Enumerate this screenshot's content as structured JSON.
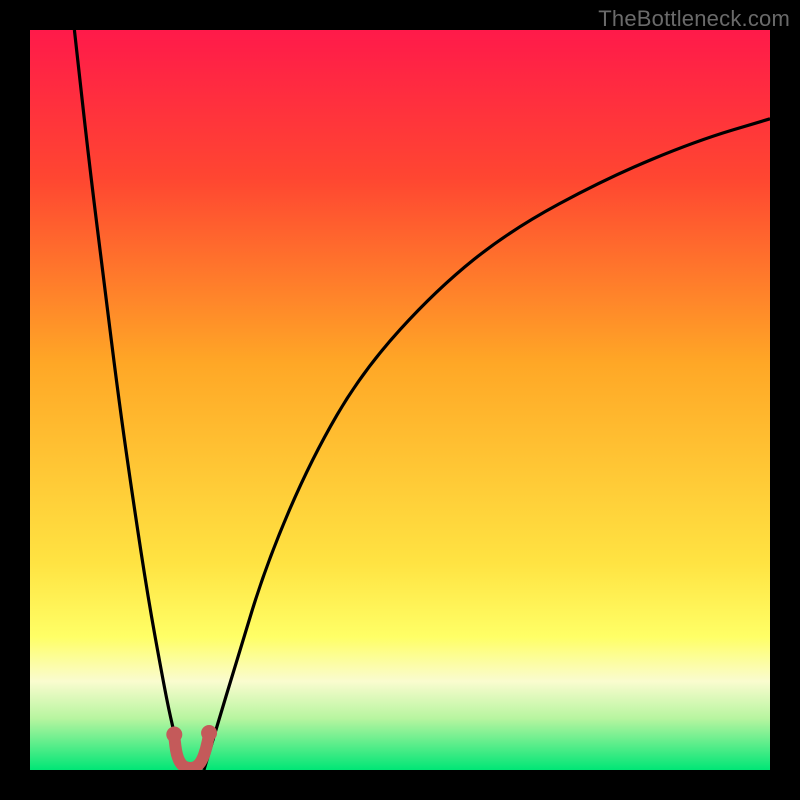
{
  "watermark": "TheBottleneck.com",
  "chart_data": {
    "type": "line",
    "title": "",
    "xlabel": "",
    "ylabel": "",
    "xlim": [
      0,
      100
    ],
    "ylim": [
      0,
      100
    ],
    "grid": false,
    "legend": false,
    "annotations": [],
    "background_gradient": {
      "stops": [
        {
          "pos": 0,
          "color": "#ff1a4a"
        },
        {
          "pos": 20,
          "color": "#ff4631"
        },
        {
          "pos": 45,
          "color": "#ffa726"
        },
        {
          "pos": 72,
          "color": "#ffe342"
        },
        {
          "pos": 82,
          "color": "#ffff66"
        },
        {
          "pos": 88,
          "color": "#fafccf"
        },
        {
          "pos": 93,
          "color": "#b8f5a0"
        },
        {
          "pos": 100,
          "color": "#00e676"
        }
      ]
    },
    "series": [
      {
        "name": "curve-left",
        "stroke": "#000000",
        "x": [
          6,
          8,
          10,
          12,
          14,
          16,
          18,
          19,
          20,
          20.8
        ],
        "y": [
          100,
          82,
          66,
          50,
          36,
          23,
          12,
          7,
          3,
          0
        ]
      },
      {
        "name": "curve-right",
        "stroke": "#000000",
        "x": [
          23.5,
          25,
          28,
          32,
          38,
          45,
          55,
          65,
          78,
          90,
          100
        ],
        "y": [
          0,
          5,
          15,
          28,
          42,
          54,
          65,
          73,
          80,
          85,
          88
        ]
      },
      {
        "name": "valley-marker",
        "stroke": "#c45a5a",
        "thick": true,
        "x": [
          19.5,
          19.8,
          20.5,
          21.5,
          22.5,
          23.2,
          23.8,
          24.2
        ],
        "y": [
          4.5,
          2.0,
          0.6,
          0.2,
          0.4,
          1.2,
          2.8,
          4.8
        ]
      }
    ],
    "valley_dots": {
      "color": "#c45a5a",
      "points": [
        {
          "x": 19.5,
          "y": 4.8
        },
        {
          "x": 24.2,
          "y": 5.0
        }
      ]
    }
  }
}
